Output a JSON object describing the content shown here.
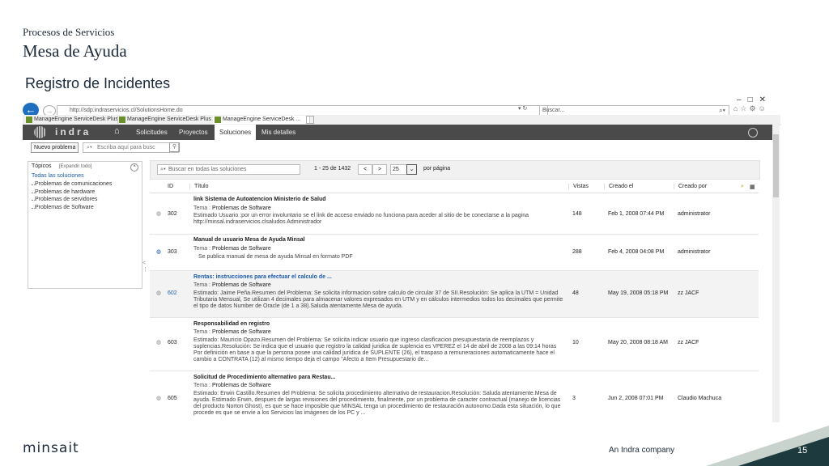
{
  "slide": {
    "subtitle": "Procesos de Servicios",
    "title": "Mesa de Ayuda",
    "heading": "Registro de Incidentes",
    "brand": "minsait",
    "company": "An Indra company",
    "page": "15"
  },
  "browser": {
    "url": "http://sdp.indraservicios.cl/SolutionsHome.do",
    "search_placeholder": "Buscar...",
    "tabs": [
      {
        "label": "ManageEngine ServiceDesk Plus"
      },
      {
        "label": "ManageEngine ServiceDesk Plus"
      },
      {
        "label": "ManageEngine ServiceDesk ..."
      }
    ]
  },
  "app": {
    "logo": "indra",
    "nav": [
      "Solicitudes",
      "Proyectos",
      "Soluciones",
      "Mis detalles"
    ],
    "active_nav": "Soluciones",
    "new_button": "Nuevo problema",
    "quick_search": "Escriba aquí para busc"
  },
  "topics": {
    "title": "Tópicos",
    "expand": "[Expandir todo]",
    "all": "Todas las soluciones",
    "items": [
      "Problemas de comunicaciones",
      "Problemas de hardware",
      "Problemas de servidores",
      "Problemas de Software"
    ]
  },
  "solutions": {
    "search_placeholder": "Buscar en todas las soluciones",
    "range": "1 - 25 de 1432",
    "per_page": "25",
    "per_page_label": "por página",
    "columns": {
      "id": "ID",
      "title": "Título",
      "views": "Vistas",
      "created": "Creado el",
      "by": "Creado por"
    },
    "rows": [
      {
        "id": "302",
        "title": "link Sistema de Autoatencion Ministerio de Salud",
        "tema_label": "Tema :",
        "tema": "Problemas de Software",
        "desc": "Estimado Usuario :por un error involuntario se el link de acceso enviado no funciona   para aceder al sitio de be conectarse a la pagina http://minsal.indraservicios.clsaludos Administrador",
        "views": "148",
        "created": "Feb 1, 2008 07:44 PM",
        "by": "administrator"
      },
      {
        "id": "303",
        "title": "Manual de usuario Mesa de Ayuda Minsal",
        "tema_label": "Tema :",
        "tema": "Problemas de Software",
        "desc": "Se publica manual de mesa de ayuda Minsal  en formato PDF",
        "views": "288",
        "created": "Feb 4, 2008 04:08 PM",
        "by": "administrator"
      },
      {
        "id": "602",
        "title": "Rentas: instrucciones para efectuar el calculo de ...",
        "tema_label": "Tema :",
        "tema": "Problemas de Software",
        "desc": "Estimado: Jaime Peña.Resumen del Problema: Se solicita informacion sobre calculo de circular 37 de SII.Resolución: Se aplica la UTM = Unidad Tributaria Mensual, Se utilizan 4 decimales para almacenar valores expresados en UTM y en cálculos intermedios todos los decimales que permite el tipo de datos Number de Oracle (de 1 a 38).Saluda atentamente.Mesa de ayuda.",
        "views": "48",
        "created": "May 19, 2008 05:18 PM",
        "by": "zz JACF"
      },
      {
        "id": "603",
        "title": "Responsabilidad en registro",
        "tema_label": "Tema :",
        "tema": "Problemas de Software",
        "desc": "Estimado: Mauricio Opazo.Resumen del Problema: Se solicita indicar usuario que ingreso clasificacion presupuestaria de reemplazos y suplencias.Resolución: Se indica que el usuario que registro la calidad juridica de suplencia es VPEREZ el 14 de abril de 2008 a las 09:14 horas Por definición en base a que la persona posee una calidad jurídica de SUPLENTE (26), el traspaso a remuneraciones automaticamente hace el cambio a CONTRATA (12) al mismo tiempo deja el campo \"Afecto a Item Presupuestario de...",
        "views": "10",
        "created": "May 20, 2008 08:18 AM",
        "by": "zz JACF"
      },
      {
        "id": "605",
        "title": "Solicitud de Procedimiento alternativo para Restau...",
        "tema_label": "Tema :",
        "tema": "Problemas de Software",
        "desc": "Estimado: Erwin Castillo.Resumen del Problema: Se solicita procedimiento alternativo de restauracion.Resolución: Saluda atentamente.Mesa de ayuda. Estimado Erwin, despues de largas revisiones del procedimiento, finalmente, por un problema de caracter contractual (manejo de licencias del producto Norton Ghost), es que se hace imposible que MINSAL tenga un procedimiento de restauración autonomo.Dada esta situación, lo que procede es que se envíe a los Servicios las imágenes de los PC y ...",
        "views": "3",
        "created": "Jun 2, 2008 07:01 PM",
        "by": "Claudio Machuca"
      }
    ]
  }
}
